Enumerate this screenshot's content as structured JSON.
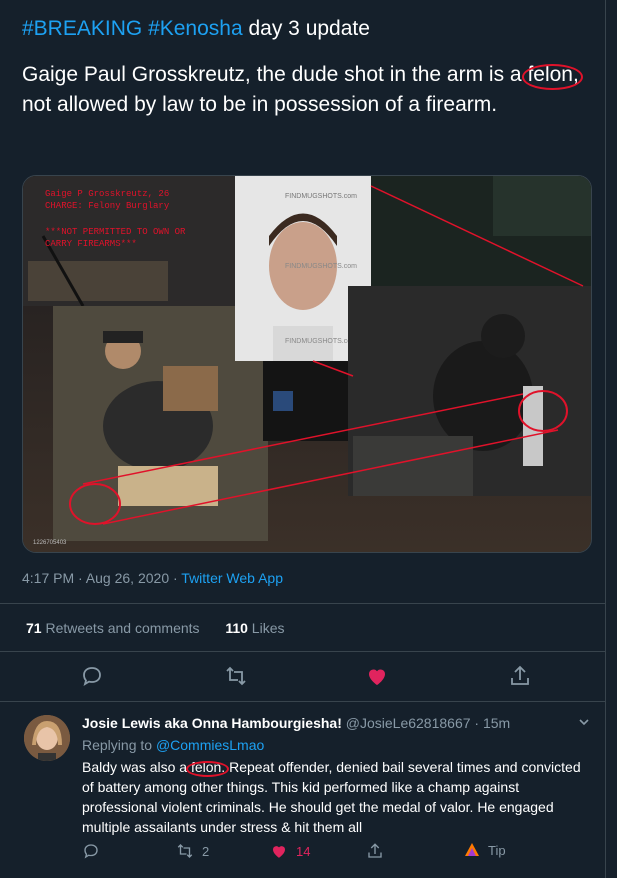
{
  "tweet": {
    "hashtag1": "#BREAKING",
    "hashtag2": "#Kenosha",
    "headline_rest": " day 3 update",
    "body_pre": "Gaige Paul Grosskreutz, the dude shot in the arm is a ",
    "body_circled": "felon,",
    "body_post": " not allowed by law to be in possession of a firearm.",
    "media": {
      "caption_line1": "Gaige P Grosskreutz, 26",
      "caption_line2": "CHARGE: Felony Burglary",
      "caption_line3": "***NOT PERMITTED TO OWN OR",
      "caption_line4": "CARRY FIREARMS***",
      "watermark": "FINDMUGSHOTS.com",
      "photo_id": "1226705403"
    },
    "time": "4:17 PM · Aug 26, 2020 · ",
    "app": "Twitter Web App",
    "retweets_count": "71",
    "retweets_label": " Retweets and comments",
    "likes_count": "110",
    "likes_label": " Likes"
  },
  "reply": {
    "name": "Josie Lewis aka Onna Hambourgiesha!",
    "handle": " @JosieLe62818667 · 15m",
    "replying_prefix": "Replying to ",
    "replying_to": "@CommiesLmao",
    "text_pre": "Baldy was also a ",
    "text_circled": "felon.",
    "text_post": " Repeat offender, denied bail several times and convicted of battery among other things. This kid performed like a champ against professional violent criminals. He should get the medal of valor. He engaged multiple assailants under stress & hit them all",
    "retweet_count": "2",
    "like_count": "14",
    "tip_label": "Tip"
  },
  "colors": {
    "background": "#15202b",
    "link": "#1da1f2",
    "like": "#e0245e",
    "muted": "#8899a6",
    "annotation_red": "#e0122a"
  },
  "icons": [
    "reply-icon",
    "retweet-icon",
    "heart-icon",
    "share-icon",
    "chevron-down-icon",
    "tip-icon"
  ]
}
